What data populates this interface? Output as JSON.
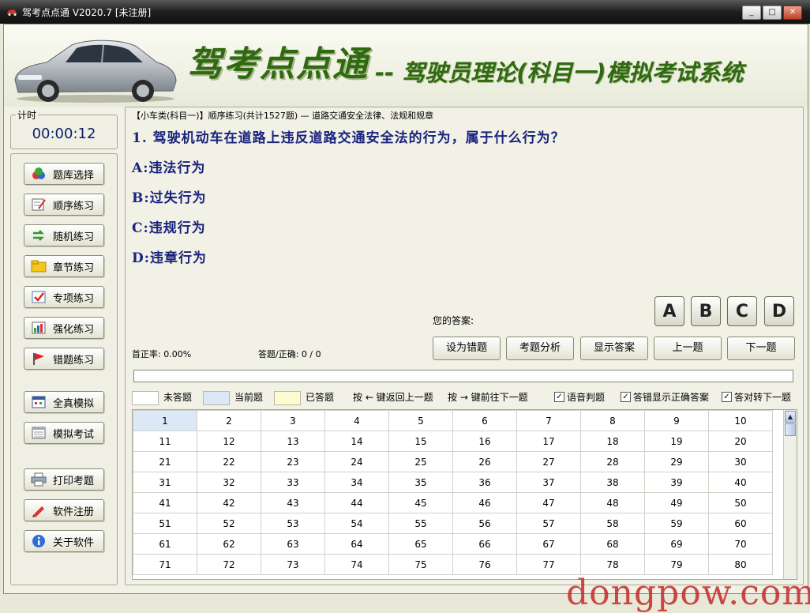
{
  "window": {
    "title": "驾考点点通 V2020.7 [未注册]",
    "controls": [
      "minimize",
      "maximize",
      "close"
    ]
  },
  "banner": {
    "brand": "驾考点点通",
    "subtitle": "-- 驾驶员理论(科目一)模拟考试系统"
  },
  "timer": {
    "label": "计时",
    "value": "00:00:12"
  },
  "sidebar": {
    "items": [
      {
        "label": "题库选择",
        "icon": "question-bank-icon"
      },
      {
        "label": "顺序练习",
        "icon": "sequence-edit-icon"
      },
      {
        "label": "随机练习",
        "icon": "random-arrows-icon"
      },
      {
        "label": "章节练习",
        "icon": "chapter-folder-icon"
      },
      {
        "label": "专项练习",
        "icon": "special-check-icon"
      },
      {
        "label": "强化练习",
        "icon": "bar-chart-icon"
      },
      {
        "label": "错题练习",
        "icon": "red-flag-icon"
      },
      {
        "label": "全真模拟",
        "icon": "exam-calendar-icon"
      },
      {
        "label": "模拟考试",
        "icon": "exam-sheet-icon"
      },
      {
        "label": "打印考题",
        "icon": "printer-icon"
      },
      {
        "label": "软件注册",
        "icon": "register-pen-icon"
      },
      {
        "label": "关于软件",
        "icon": "info-icon"
      }
    ]
  },
  "question": {
    "breadcrumb": "【小车类(科目一)】顺序练习(共计1527题) — 道路交通安全法律、法规和规章",
    "text": "1. 驾驶机动车在道路上违反道路交通安全法的行为，属于什么行为？",
    "options": [
      "A:违法行为",
      "B:过失行为",
      "C:违规行为",
      "D:违章行为"
    ]
  },
  "answer": {
    "label": "您的答案:",
    "choices": [
      "A",
      "B",
      "C",
      "D"
    ]
  },
  "stats": {
    "first_correct": "首正率: 0.00%",
    "answered": "答题/正确: 0 / 0"
  },
  "actions": [
    "设为错题",
    "考题分析",
    "显示答案",
    "上一题",
    "下一题"
  ],
  "progress": {
    "value_pct": 0
  },
  "legend": {
    "unanswered": "未答题",
    "current": "当前题",
    "answered": "已答题",
    "prev_hint": "按 ← 键返回上一题",
    "next_hint": "按 → 键前往下一题"
  },
  "options": {
    "voice": {
      "label": "语音判题",
      "checked": true
    },
    "show_correct": {
      "label": "答错显示正确答案",
      "checked": true
    },
    "auto_next": {
      "label": "答对转下一题",
      "checked": true
    }
  },
  "grid": {
    "current": 1,
    "rows": [
      [
        1,
        2,
        3,
        4,
        5,
        6,
        7,
        8,
        9,
        10
      ],
      [
        11,
        12,
        13,
        14,
        15,
        16,
        17,
        18,
        19,
        20
      ],
      [
        21,
        22,
        23,
        24,
        25,
        26,
        27,
        28,
        29,
        30
      ],
      [
        31,
        32,
        33,
        34,
        35,
        36,
        37,
        38,
        39,
        40
      ],
      [
        41,
        42,
        43,
        44,
        45,
        46,
        47,
        48,
        49,
        50
      ],
      [
        51,
        52,
        53,
        54,
        55,
        56,
        57,
        58,
        59,
        60
      ],
      [
        61,
        62,
        63,
        64,
        65,
        66,
        67,
        68,
        69,
        70
      ],
      [
        71,
        72,
        73,
        74,
        75,
        76,
        77,
        78,
        79,
        80
      ]
    ]
  },
  "watermark": "dongpow.com",
  "colors": {
    "brand_green": "#2f6a10",
    "question_blue": "#1a237e",
    "current_cell": "#dce8f5",
    "unanswered_cell": "#ffffff",
    "answered_cell": "#fffbd0"
  }
}
